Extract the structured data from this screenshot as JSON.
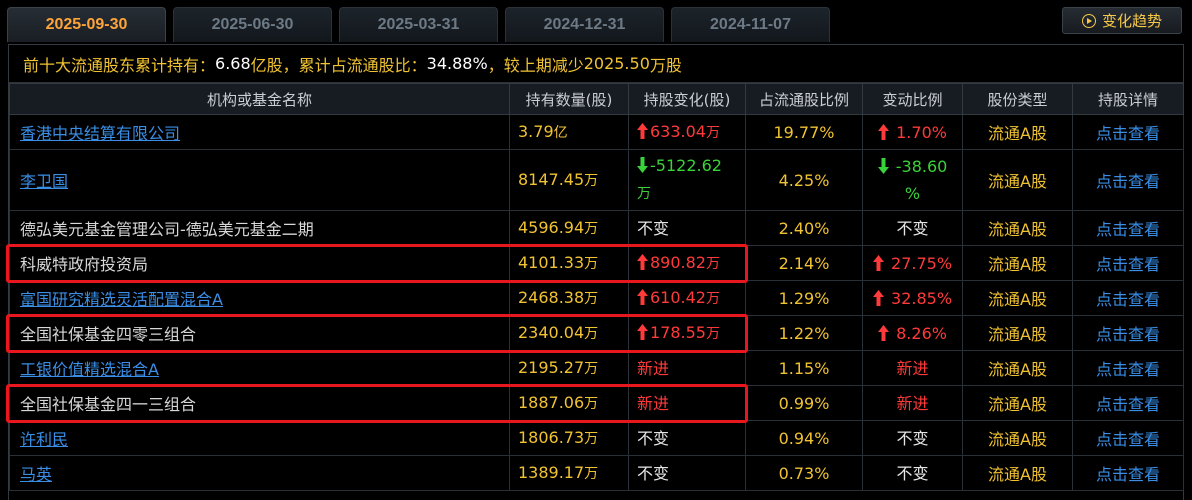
{
  "tabs": [
    {
      "label": "2025-09-30",
      "active": true
    },
    {
      "label": "2025-06-30",
      "active": false
    },
    {
      "label": "2025-03-31",
      "active": false
    },
    {
      "label": "2024-12-31",
      "active": false
    },
    {
      "label": "2024-11-07",
      "active": false
    }
  ],
  "trend_button": {
    "label": "变化趋势",
    "icon": "play-circle-icon"
  },
  "summary": {
    "label1": "前十大流通股东累计持有：",
    "value1": "6.68",
    "unit1": "亿股",
    "label2": "，累计占流通股比：",
    "value2": "34.88%",
    "label3": "，较上期减少",
    "value3": "2025.50",
    "unit3": "万股"
  },
  "columns": [
    "机构或基金名称",
    "持有数量(股)",
    "持股变化(股)",
    "占流通股比例",
    "变动比例",
    "股份类型",
    "持股详情"
  ],
  "colors": {
    "up": "#ff3a3a",
    "down": "#3ad23a",
    "accent": "#f1c232",
    "link": "#3a8ee6",
    "highlight": "#e8171e"
  },
  "rows": [
    {
      "name": "香港中央结算有限公司",
      "link": true,
      "qty": "3.79",
      "qty_unit": "亿",
      "chg_dir": "up",
      "chg": "633.04",
      "chg_unit": "万",
      "ratio": "19.77%",
      "var_dir": "up",
      "var": "1.70%",
      "type": "流通A股",
      "detail": "点击查看"
    },
    {
      "name": "李卫国",
      "link": true,
      "qty": "8147.45",
      "qty_unit": "万",
      "chg_dir": "down",
      "chg": "-5122.62",
      "chg_unit": "万",
      "ratio": "4.25%",
      "var_dir": "down",
      "var": "-38.60",
      "var_unit": "%",
      "type": "流通A股",
      "detail": "点击查看"
    },
    {
      "name": "德弘美元基金管理公司-德弘美元基金二期",
      "link": false,
      "qty": "4596.94",
      "qty_unit": "万",
      "chg_dir": "none",
      "chg": "不变",
      "ratio": "2.40%",
      "var_dir": "none",
      "var": "不变",
      "type": "流通A股",
      "detail": "点击查看"
    },
    {
      "name": "科威特政府投资局",
      "link": false,
      "qty": "4101.33",
      "qty_unit": "万",
      "chg_dir": "up",
      "chg": "890.82",
      "chg_unit": "万",
      "ratio": "2.14%",
      "var_dir": "up",
      "var": "27.75%",
      "type": "流通A股",
      "detail": "点击查看"
    },
    {
      "name": "富国研究精选灵活配置混合A",
      "link": true,
      "qty": "2468.38",
      "qty_unit": "万",
      "chg_dir": "up",
      "chg": "610.42",
      "chg_unit": "万",
      "ratio": "1.29%",
      "var_dir": "up",
      "var": "32.85%",
      "type": "流通A股",
      "detail": "点击查看"
    },
    {
      "name": "全国社保基金四零三组合",
      "link": false,
      "qty": "2340.04",
      "qty_unit": "万",
      "chg_dir": "up",
      "chg": "178.55",
      "chg_unit": "万",
      "ratio": "1.22%",
      "var_dir": "up",
      "var": "8.26%",
      "type": "流通A股",
      "detail": "点击查看"
    },
    {
      "name": "工银价值精选混合A",
      "link": true,
      "qty": "2195.27",
      "qty_unit": "万",
      "chg_dir": "new",
      "chg": "新进",
      "ratio": "1.15%",
      "var_dir": "new",
      "var": "新进",
      "type": "流通A股",
      "detail": "点击查看"
    },
    {
      "name": "全国社保基金四一三组合",
      "link": false,
      "qty": "1887.06",
      "qty_unit": "万",
      "chg_dir": "new",
      "chg": "新进",
      "ratio": "0.99%",
      "var_dir": "new",
      "var": "新进",
      "type": "流通A股",
      "detail": "点击查看"
    },
    {
      "name": "许利民",
      "link": true,
      "qty": "1806.73",
      "qty_unit": "万",
      "chg_dir": "none",
      "chg": "不变",
      "ratio": "0.94%",
      "var_dir": "none",
      "var": "不变",
      "type": "流通A股",
      "detail": "点击查看"
    },
    {
      "name": "马英",
      "link": true,
      "qty": "1389.17",
      "qty_unit": "万",
      "chg_dir": "none",
      "chg": "不变",
      "ratio": "0.73%",
      "var_dir": "none",
      "var": "不变",
      "type": "流通A股",
      "detail": "点击查看"
    }
  ],
  "highlighted_rows": [
    3,
    5,
    7
  ]
}
